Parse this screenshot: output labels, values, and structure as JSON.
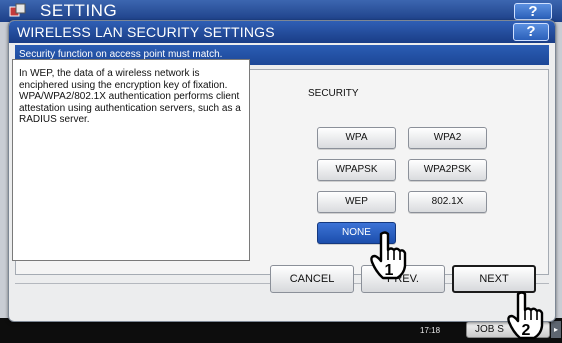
{
  "background": {
    "title": "SETTING",
    "help_label": "?",
    "clock": "17:18",
    "job_status_label": "JOB S",
    "scroll_arrow": "▸"
  },
  "dialog": {
    "title": "WIRELESS LAN SECURITY SETTINGS",
    "help_label": "?",
    "message": "Security function on access point must match.",
    "info_text": "In WEP, the data of a wireless network is enciphered using the encryption key of fixation. WPA/WPA2/802.1X authentication performs client attestation using authentication servers, such as a RADIUS server.",
    "security_label": "SECURITY",
    "security_options": [
      "WPA",
      "WPA2",
      "WPAPSK",
      "WPA2PSK",
      "WEP",
      "802.1X",
      "NONE"
    ],
    "selected_option": "NONE",
    "buttons": {
      "cancel": "CANCEL",
      "prev": "PREV.",
      "next": "NEXT"
    }
  },
  "callouts": [
    "1",
    "2"
  ],
  "colors": {
    "titlebar": "#1f4a99",
    "selected": "#1c4eac",
    "background": "#c9cdd4"
  },
  "icons": [
    "settings-icon",
    "hand-pointer-icon"
  ]
}
